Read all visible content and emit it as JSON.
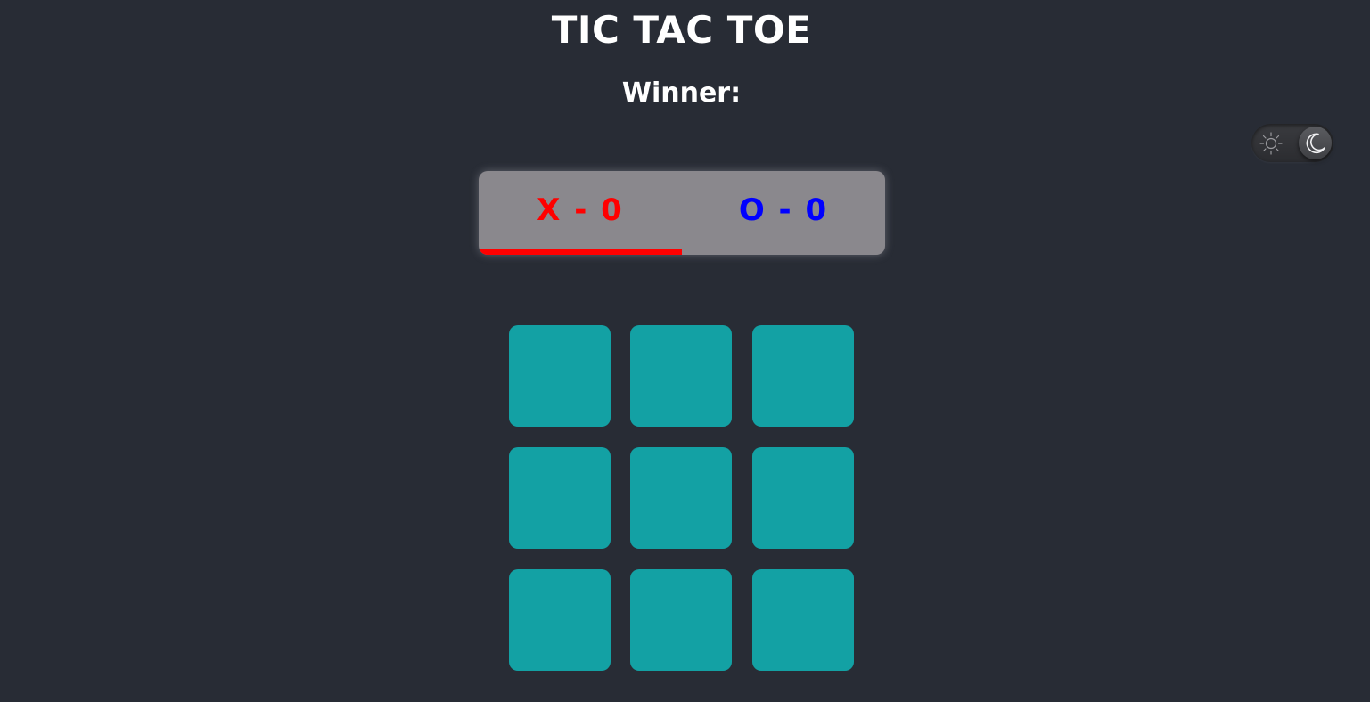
{
  "title": "TIC TAC TOE",
  "winner_label": "Winner:",
  "theme_toggle": {
    "left_icon": "sun-icon",
    "right_icon": "moon-icon",
    "mode": "dark"
  },
  "scoreboard": {
    "x_score": "X - 0",
    "o_score": "O - 0",
    "current_turn": "X",
    "x_color": "#ff0000",
    "o_color": "#0000ff"
  },
  "board": {
    "cells": [
      "",
      "",
      "",
      "",
      "",
      "",
      "",
      "",
      ""
    ],
    "cell_color": "#13a1a4"
  },
  "colors": {
    "background": "#282c35",
    "scoreboard_bg": "#8a888d"
  }
}
